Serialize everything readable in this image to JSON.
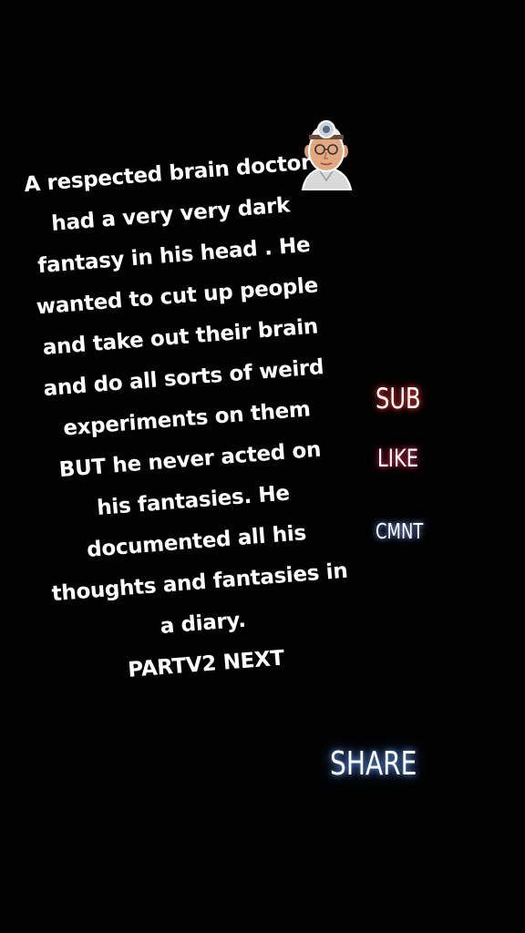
{
  "story": {
    "lines": [
      "A respected brain doctor",
      "had a very very dark",
      "fantasy in his head . He",
      "wanted to cut up people",
      "and take out their brain",
      "and do all sorts of weird",
      "experiments on them",
      "BUT he never acted on",
      "his fantasies. He",
      "documented all his",
      "thoughts and fantasies in",
      "a diary.",
      "PARTV2 NEXT"
    ]
  },
  "sticker": {
    "icon": "doctor-head-mirror-sticker-icon"
  },
  "actions": {
    "sub": "SUB",
    "like": "LIKE",
    "cmnt": "CMNT",
    "share": "SHARE"
  },
  "colors": {
    "background": "#020202",
    "text": "#ffffff",
    "sub_glow": "#ff4646",
    "like_glow": "#ff3c78",
    "cmnt_glow": "#8caaff",
    "share_glow": "#6eaaff"
  }
}
